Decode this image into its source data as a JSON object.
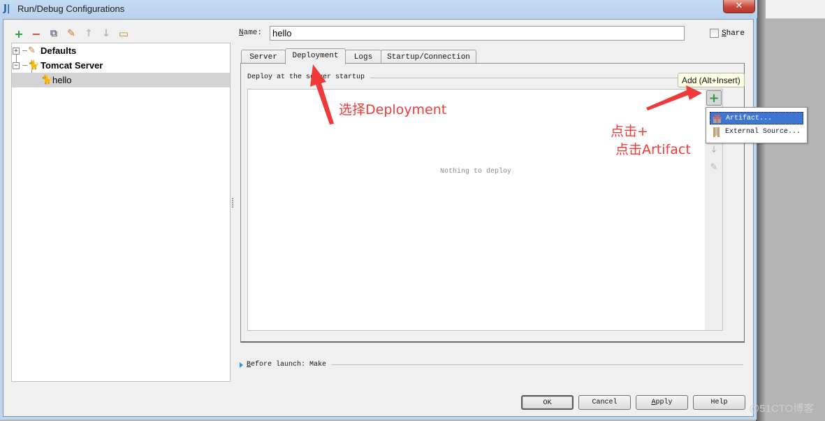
{
  "window": {
    "title": "Run/Debug Configurations",
    "close_glyph": "✕"
  },
  "toolbar": {
    "items": [
      {
        "name": "add",
        "glyph": "+",
        "color": "#2a9a3a"
      },
      {
        "name": "remove",
        "glyph": "−",
        "color": "#d9443a"
      },
      {
        "name": "copy",
        "glyph": "⧉",
        "color": "#6b7a8c"
      },
      {
        "name": "edit-defaults",
        "glyph": "✎",
        "color": "#c77a22"
      },
      {
        "name": "move-up",
        "glyph": "↑",
        "color": "#b4b4b4"
      },
      {
        "name": "move-down",
        "glyph": "↓",
        "color": "#b4b4b4"
      },
      {
        "name": "folder",
        "glyph": "▭",
        "color": "#c48a2e"
      }
    ]
  },
  "tree": {
    "items": [
      {
        "label": "Defaults",
        "expander": "+",
        "icon": "wrench-icon",
        "bold": true
      },
      {
        "label": "Tomcat Server",
        "expander": "−",
        "icon": "tomcat-icon",
        "bold": true
      },
      {
        "label": "hello",
        "icon": "tomcat-icon",
        "bold": false,
        "selected": true
      }
    ]
  },
  "form": {
    "name_label_prefix": "N",
    "name_label_rest": "ame:",
    "name_value": "hello",
    "share_label_prefix": "S",
    "share_label_rest": "hare",
    "share_checked": false
  },
  "tabs": [
    {
      "label": "Server",
      "active": false
    },
    {
      "label": "Deployment",
      "active": true
    },
    {
      "label": "Logs",
      "active": false
    },
    {
      "label": "Startup/Connection",
      "active": false
    }
  ],
  "deployment": {
    "section_title": "Deploy at the server startup",
    "empty_text": "Nothing to deploy",
    "add_glyph": "+",
    "tooltip": "Add (Alt+Insert)",
    "popup_items": [
      {
        "label": "Artifact...",
        "highlighted": true
      },
      {
        "label": "External Source...",
        "highlighted": false
      }
    ]
  },
  "before_launch": {
    "prefix": "B",
    "rest": "efore launch: Make"
  },
  "buttons": {
    "ok": "OK",
    "cancel": "Cancel",
    "apply_prefix": "A",
    "apply_rest": "pply",
    "help": "Help"
  },
  "annotations": {
    "select_deployment": "选择Deployment",
    "click_plus": "点击+",
    "click_artifact": "点击Artifact",
    "color": "#f03a3a"
  },
  "watermark": "@51CTO博客"
}
